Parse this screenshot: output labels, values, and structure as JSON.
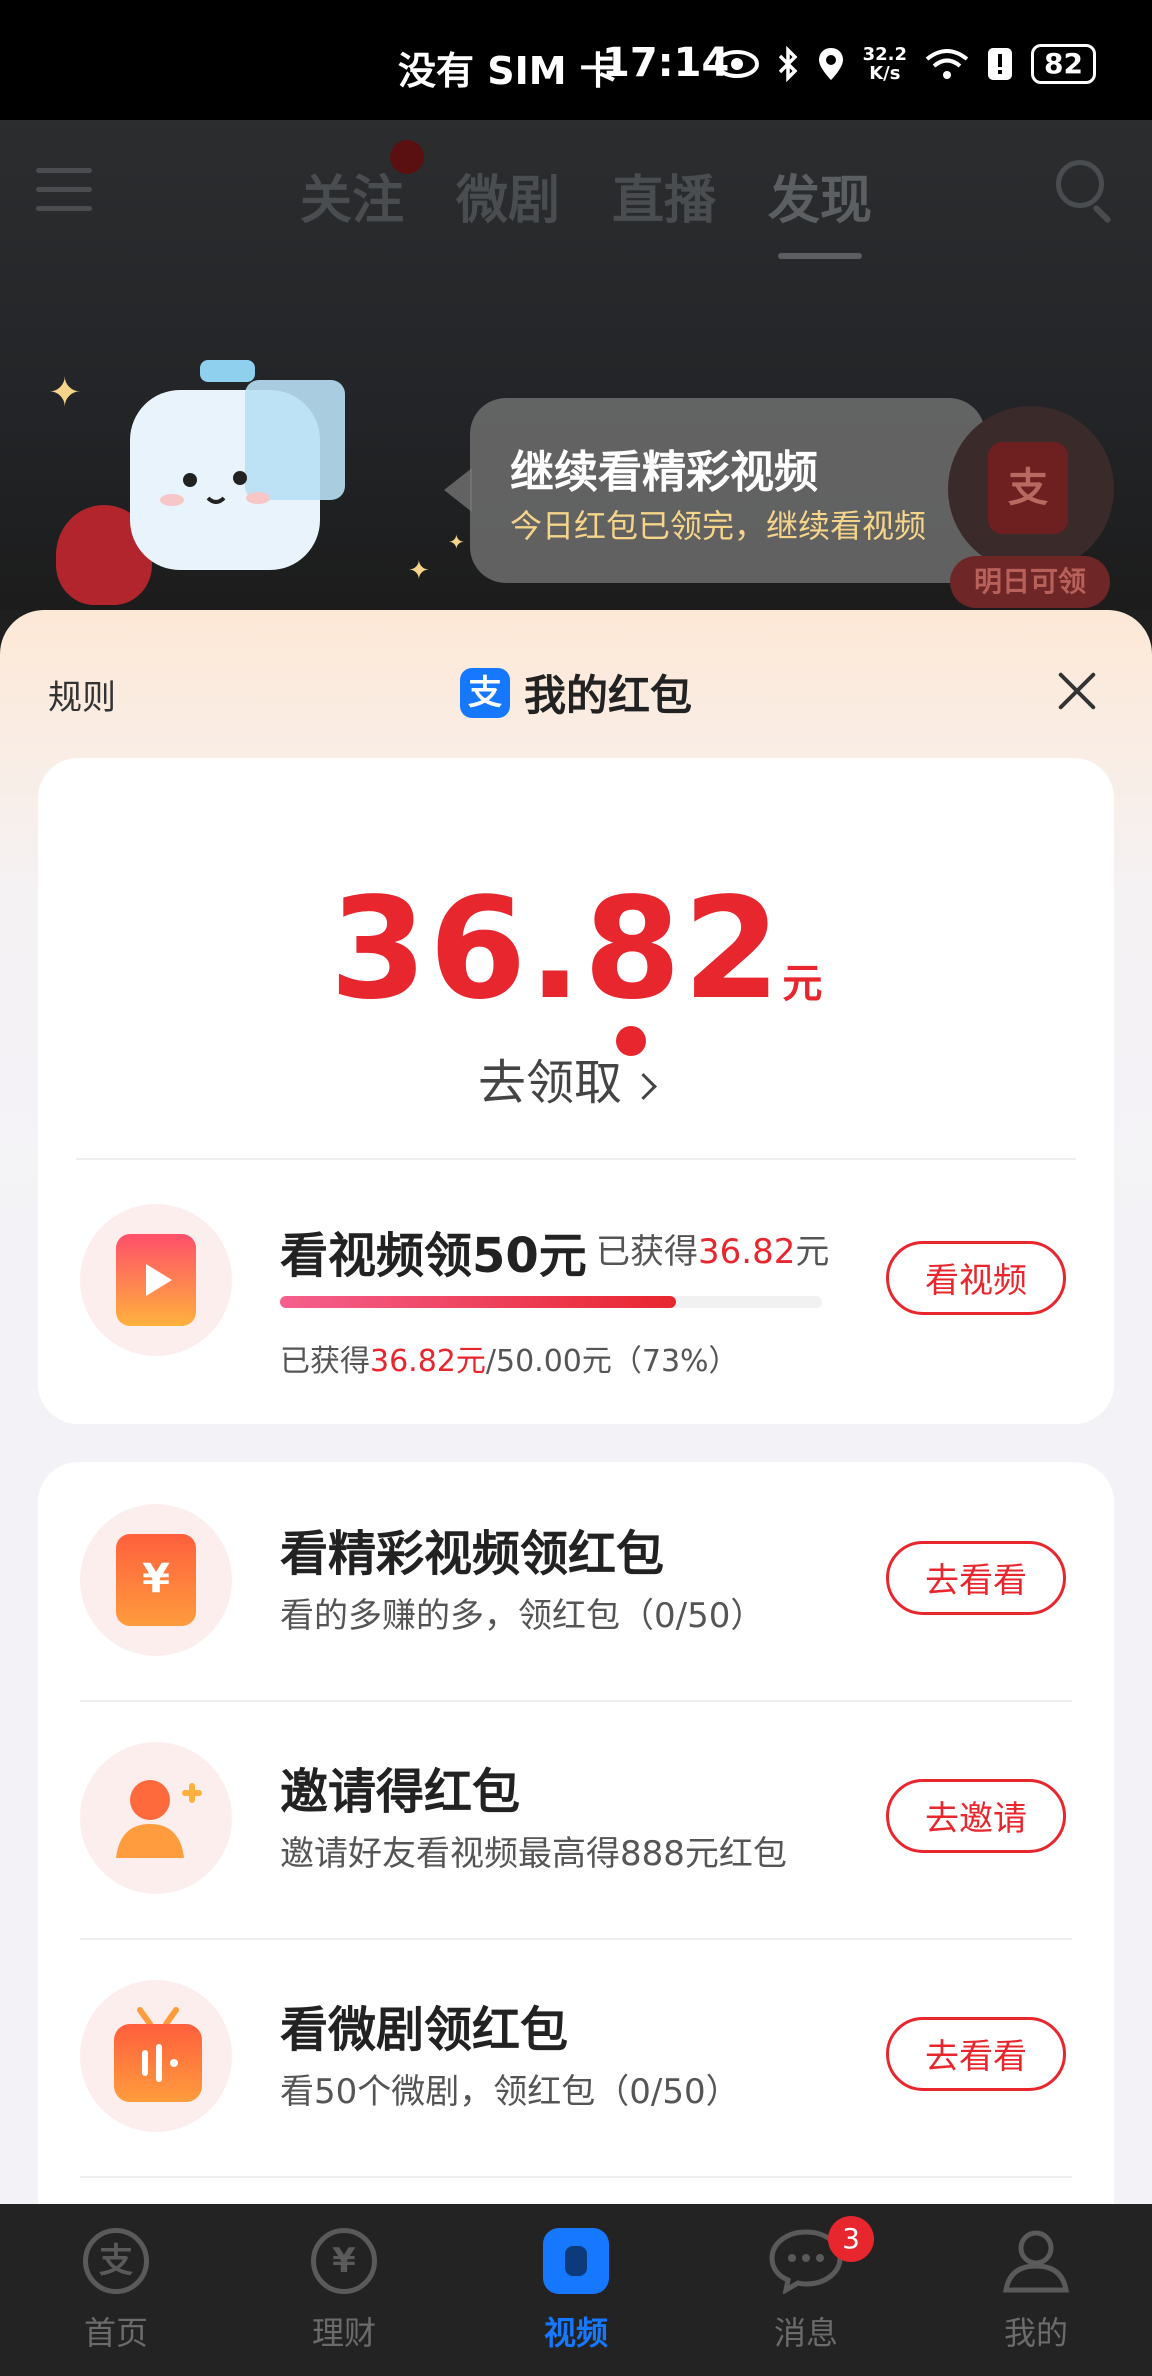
{
  "status_bar": {
    "sim": "没有 SIM 卡",
    "time": "17:14",
    "net_speed_value": "32.2",
    "net_speed_unit": "K/s",
    "battery": "82"
  },
  "top_nav": {
    "tabs": [
      "关注",
      "微剧",
      "直播",
      "发现"
    ],
    "active_tab": "发现"
  },
  "promo": {
    "bubble_title": "继续看精彩视频",
    "bubble_subtitle": "今日红包已领完，继续看视频",
    "float_icon_char": "支",
    "tomorrow_label": "明日可领"
  },
  "sheet": {
    "rules": "规则",
    "logo_char": "支",
    "title": "我的红包",
    "amount": "36.82",
    "amount_unit": "元",
    "claim": "去领取"
  },
  "main_task": {
    "title": "看视频领50元",
    "earned_prefix": "已获得",
    "earned_value": "36.82",
    "earned_unit": "元",
    "progress_prefix": "已获得",
    "progress_earned": "36.82元",
    "progress_rest": "/50.00元（73%）",
    "progress_fraction": 0.73,
    "button": "看视频"
  },
  "tasks": [
    {
      "title": "看精彩视频领红包",
      "desc": "看的多赚的多，领红包（0/50）",
      "button": "去看看",
      "icon": "yuan-icon"
    },
    {
      "title": "邀请得红包",
      "desc": "邀请好友看视频最高得888元红包",
      "button": "去邀请",
      "icon": "add-user-icon"
    },
    {
      "title": "看微剧领红包",
      "desc": "看50个微剧，领红包（0/50）",
      "button": "去看看",
      "icon": "tv-icon"
    }
  ],
  "bottom_nav": {
    "items": [
      "首页",
      "理财",
      "视频",
      "消息",
      "我的"
    ],
    "active": "视频",
    "message_badge": "3",
    "home_char": "支",
    "finance_char": "¥"
  },
  "colors": {
    "accent_red": "#e8262e",
    "alipay_blue": "#1677ff"
  }
}
